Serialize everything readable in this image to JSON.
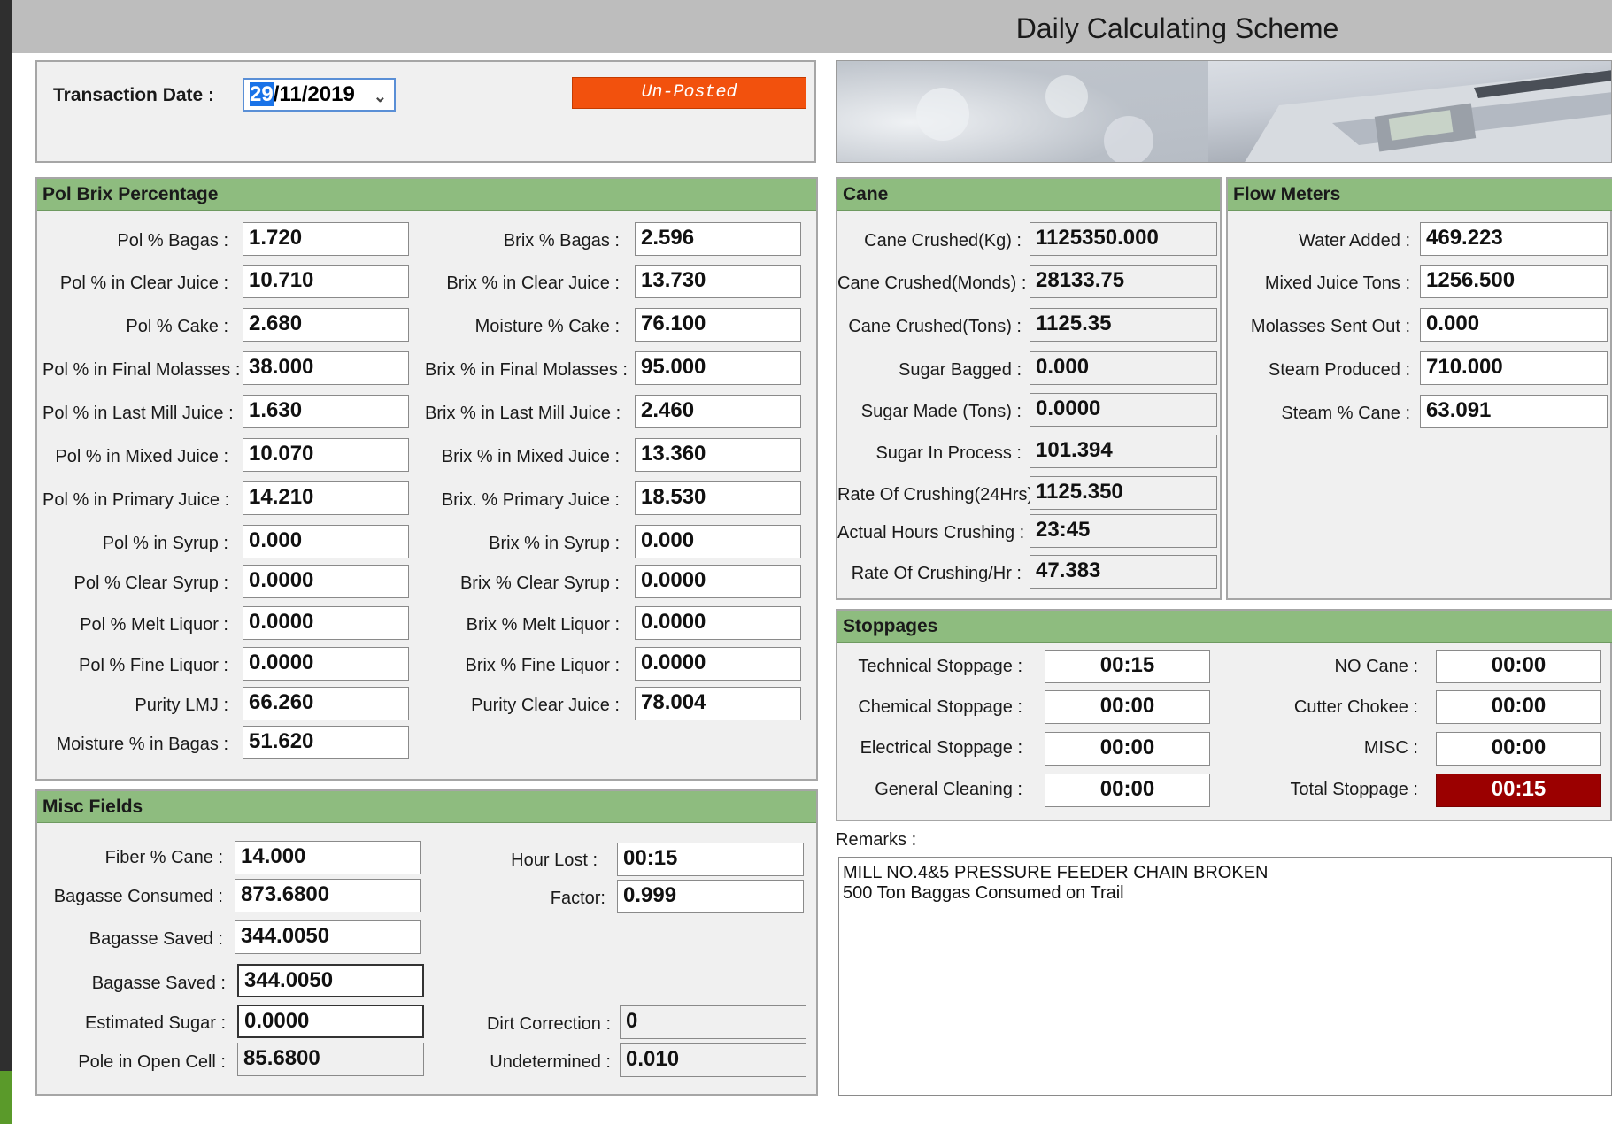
{
  "app": {
    "title": "Daily Calculating Scheme"
  },
  "header": {
    "transaction_date_label": "Transaction Date :",
    "date_selected": "29",
    "date_rest": "/11/2019",
    "status": "Un-Posted"
  },
  "pol_brix": {
    "title": "Pol  Brix Percentage",
    "left": [
      {
        "label": "Pol % Bagas :",
        "value": "1.720"
      },
      {
        "label": "Pol % in Clear Juice :",
        "value": "10.710"
      },
      {
        "label": "Pol % Cake :",
        "value": "2.680"
      },
      {
        "label": "Pol % in Final Molasses :",
        "value": "38.000"
      },
      {
        "label": "Pol % in Last Mill Juice :",
        "value": "1.630"
      },
      {
        "label": "Pol % in Mixed Juice :",
        "value": "10.070"
      },
      {
        "label": "Pol % in Primary Juice :",
        "value": "14.210"
      },
      {
        "label": "Pol % in Syrup :",
        "value": "0.000"
      },
      {
        "label": "Pol % Clear Syrup :",
        "value": "0.0000"
      },
      {
        "label": "Pol % Melt Liquor :",
        "value": "0.0000"
      },
      {
        "label": "Pol % Fine Liquor :",
        "value": "0.0000"
      },
      {
        "label": "Purity LMJ :",
        "value": "66.260"
      },
      {
        "label": "Moisture % in Bagas :",
        "value": "51.620"
      }
    ],
    "right": [
      {
        "label": "Brix % Bagas :",
        "value": "2.596"
      },
      {
        "label": "Brix % in Clear Juice  :",
        "value": "13.730"
      },
      {
        "label": "Moisture % Cake :",
        "value": "76.100"
      },
      {
        "label": "Brix % in Final Molasses :",
        "value": "95.000"
      },
      {
        "label": "Brix % in Last Mill Juice :",
        "value": "2.460"
      },
      {
        "label": "Brix % in Mixed Juice :",
        "value": "13.360"
      },
      {
        "label": "Brix. % Primary Juice :",
        "value": "18.530"
      },
      {
        "label": "Brix % in Syrup :",
        "value": "0.000"
      },
      {
        "label": "Brix % Clear Syrup :",
        "value": "0.0000"
      },
      {
        "label": "Brix % Melt Liquor :",
        "value": "0.0000"
      },
      {
        "label": "Brix % Fine Liquor :",
        "value": "0.0000"
      },
      {
        "label": "Purity Clear Juice :",
        "value": "78.004"
      }
    ]
  },
  "misc": {
    "title": "Misc Fields",
    "fiber_cane": {
      "label": "Fiber % Cane :",
      "value": "14.000"
    },
    "bagasse_consumed": {
      "label": "Bagasse Consumed  :",
      "value": "873.6800"
    },
    "bagasse_saved_1": {
      "label": "Bagasse Saved :",
      "value": "344.0050"
    },
    "bagasse_saved_2": {
      "label": "Bagasse Saved :",
      "value": "344.0050"
    },
    "estimated_sugar": {
      "label": "Estimated Sugar :",
      "value": "0.0000"
    },
    "pole_open_cell": {
      "label": "Pole in Open Cell :",
      "value": "85.6800"
    },
    "hour_lost": {
      "label": "Hour Lost :",
      "value": "00:15"
    },
    "factor": {
      "label": "Factor:",
      "value": "0.999"
    },
    "dirt_correction": {
      "label": "Dirt Correction :",
      "value": "0"
    },
    "undetermined": {
      "label": "Undetermined :",
      "value": "0.010"
    }
  },
  "cane": {
    "title": "Cane",
    "rows": [
      {
        "label": "Cane Crushed(Kg) :",
        "value": "1125350.000"
      },
      {
        "label": "Cane Crushed(Monds) :",
        "value": "28133.75"
      },
      {
        "label": "Cane Crushed(Tons) :",
        "value": "1125.35"
      },
      {
        "label": "Sugar Bagged :",
        "value": "0.000"
      },
      {
        "label": "Sugar Made (Tons) :",
        "value": "0.0000"
      },
      {
        "label": "Sugar In Process :",
        "value": "101.394"
      },
      {
        "label": "Rate Of Crushing(24Hrs) :",
        "value": "1125.350"
      },
      {
        "label": "Actual Hours Crushing :",
        "value": "23:45"
      },
      {
        "label": "Rate Of Crushing/Hr :",
        "value": "47.383"
      }
    ]
  },
  "flow": {
    "title": "Flow Meters",
    "rows": [
      {
        "label": "Water Added :",
        "value": "469.223"
      },
      {
        "label": "Mixed Juice Tons :",
        "value": "1256.500"
      },
      {
        "label": "Molasses Sent Out :",
        "value": "0.000"
      },
      {
        "label": "Steam Produced :",
        "value": "710.000"
      },
      {
        "label": "Steam % Cane :",
        "value": "63.091"
      }
    ]
  },
  "stoppages": {
    "title": "Stoppages",
    "technical": {
      "label": "Technical Stoppage :",
      "value": "00:15"
    },
    "chemical": {
      "label": "Chemical Stoppage :",
      "value": "00:00"
    },
    "electrical": {
      "label": "Electrical Stoppage :",
      "value": "00:00"
    },
    "general": {
      "label": "General Cleaning :",
      "value": "00:00"
    },
    "no_cane": {
      "label": "NO Cane :",
      "value": "00:00"
    },
    "cutter": {
      "label": "Cutter Chokee :",
      "value": "00:00"
    },
    "misc": {
      "label": "MISC :",
      "value": "00:00"
    },
    "total": {
      "label": "Total Stoppage :",
      "value": "00:15"
    }
  },
  "remarks": {
    "label": "Remarks :",
    "line1": "MILL NO.4&5 PRESSURE FEEDER CHAIN BROKEN",
    "line2": "500 Ton Baggas Consumed on Trail"
  },
  "colors": {
    "section_header": "#8ebc7f",
    "status": "#f2510d",
    "total_stoppage": "#9b0000",
    "selection": "#1a73e8"
  }
}
